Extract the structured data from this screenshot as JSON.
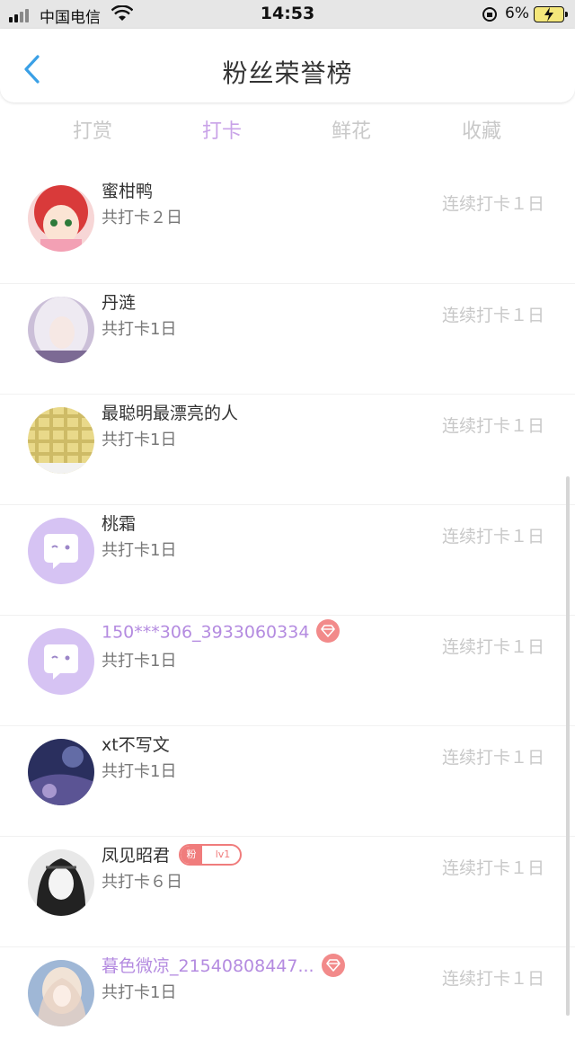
{
  "status_bar": {
    "carrier": "中国电信",
    "time": "14:53",
    "battery_percent": "6%",
    "battery_level": 0.06
  },
  "header": {
    "title": "粉丝荣誉榜",
    "back_icon": "chevron-left-icon"
  },
  "tabs": [
    {
      "label": "打赏",
      "active": false
    },
    {
      "label": "打卡",
      "active": true
    },
    {
      "label": "鲜花",
      "active": false
    },
    {
      "label": "收藏",
      "active": false
    }
  ],
  "colors": {
    "accent": "#c9a3e8",
    "name_purple": "#b48be0",
    "badge_red": "#f07c7c"
  },
  "list": [
    {
      "name": "蜜柑鸭",
      "sub": "共打卡２日",
      "streak": "连续打卡１日",
      "avatar": "avatar-anime-girl-red",
      "vip": false,
      "gem": false,
      "fan_badge": null
    },
    {
      "name": "丹涟",
      "sub": "共打卡1日",
      "streak": "连续打卡１日",
      "avatar": "avatar-white-hair-girl",
      "vip": false,
      "gem": false,
      "fan_badge": null
    },
    {
      "name": "最聪明最漂亮的人",
      "sub": "共打卡1日",
      "streak": "连续打卡１日",
      "avatar": "avatar-yellow-grid",
      "vip": false,
      "gem": false,
      "fan_badge": null
    },
    {
      "name": "桃霜",
      "sub": "共打卡1日",
      "streak": "连续打卡１日",
      "avatar": "avatar-default-chat",
      "vip": false,
      "gem": false,
      "fan_badge": null
    },
    {
      "name": "150***306_3933060334",
      "sub": "共打卡1日",
      "streak": "连续打卡１日",
      "avatar": "avatar-default-chat",
      "vip": true,
      "gem": true,
      "fan_badge": null
    },
    {
      "name": "xt不写文",
      "sub": "共打卡1日",
      "streak": "连续打卡１日",
      "avatar": "avatar-dark-blue",
      "vip": false,
      "gem": false,
      "fan_badge": null
    },
    {
      "name": "凤见昭君",
      "sub": "共打卡６日",
      "streak": "连续打卡１日",
      "avatar": "avatar-bw-sketch",
      "vip": false,
      "gem": false,
      "fan_badge": {
        "fan": "粉",
        "level": "lv1"
      }
    },
    {
      "name": "暮色微凉_21540808447...",
      "sub": "共打卡1日",
      "streak": "连续打卡１日",
      "avatar": "avatar-pastel-girl",
      "vip": true,
      "gem": true,
      "fan_badge": null
    }
  ]
}
